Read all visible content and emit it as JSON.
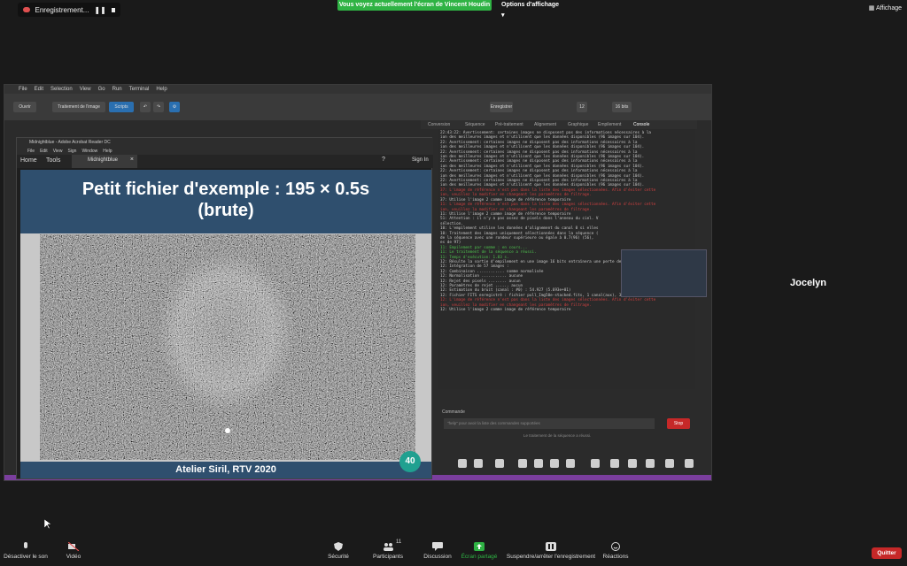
{
  "zoom": {
    "recording_label": "Enregistrement...",
    "share_banner": "Vous voyez actuellement l'écran de Vincent Houdin",
    "view_options": "Options d'affichage",
    "display_btn": "Affichage",
    "participant_name": "Jocelyn",
    "bottom": {
      "mute": "Désactiver le son",
      "video": "Vidéo",
      "security": "Sécurité",
      "participants": "Participants",
      "participants_count": "11",
      "discussion": "Discussion",
      "share": "Écran partagé",
      "record": "Suspendre/arrêter l'enregistrement",
      "reactions": "Réactions",
      "quit": "Quitter"
    }
  },
  "siril": {
    "menu": [
      "File",
      "Edit",
      "Selection",
      "View",
      "Go",
      "Run",
      "Terminal",
      "Help"
    ],
    "toolbar": {
      "open": "Ouvrir",
      "image_processing": "Traitement de l'image",
      "scripts": "Scripts",
      "save": "Enregistrer",
      "zoom_value": "12",
      "bits": "16 bits"
    },
    "tabs": [
      "Conversion",
      "Séquence",
      "Pré-traitement",
      "Alignement",
      "Graphique",
      "Empilement",
      "Console"
    ],
    "console_lines": [
      {
        "t": "22:43:22: Avertissement: certaines images ne disposent pas des informations nécessaires à la",
        "c": ""
      },
      {
        "t": "ion des meilleures images et n'utilisent que les données disponibles (96 images sur 104).",
        "c": ""
      },
      {
        "t": "22: Avertissement: certaines images ne disposent pas des informations nécessaires à la",
        "c": ""
      },
      {
        "t": "ion des meilleures images et n'utilisent que les données disponibles (96 images sur 104).",
        "c": ""
      },
      {
        "t": "22: Avertissement: certaines images ne disposent pas des informations nécessaires à la",
        "c": ""
      },
      {
        "t": "ion des meilleures images et n'utilisent que les données disponibles (96 images sur 104).",
        "c": ""
      },
      {
        "t": "22: Avertissement: certaines images ne disposent pas des informations nécessaires à la",
        "c": ""
      },
      {
        "t": "ion des meilleures images et n'utilisent que les données disponibles (96 images sur 104).",
        "c": ""
      },
      {
        "t": "22: Avertissement: certaines images ne disposent pas des informations nécessaires à la",
        "c": ""
      },
      {
        "t": "ion des meilleures images et n'utilisent que les données disponibles (96 images sur 104).",
        "c": ""
      },
      {
        "t": "22: Avertissement: certaines images ne disposent pas des informations nécessaires à la",
        "c": ""
      },
      {
        "t": "ion des meilleures images et n'utilisent que les données disponibles (96 images sur 104).",
        "c": ""
      },
      {
        "t": "37: L'image de référence n'est pas dans la liste des images sélectionnées. Afin d'éviter cette",
        "c": "red"
      },
      {
        "t": "ion, veuillez la modifier en changeant les paramètres de filtrage.",
        "c": "red"
      },
      {
        "t": "37: Utilise l'image 2 comme image de référence temporaire",
        "c": ""
      },
      {
        "t": "11: L'image de référence n'est pas dans la liste des images sélectionnées. Afin d'éviter cette",
        "c": "red"
      },
      {
        "t": "ion, veuillez la modifier en changeant les paramètres de filtrage.",
        "c": "red"
      },
      {
        "t": "11: Utilise l'image 2 comme image de référence temporaire",
        "c": ""
      },
      {
        "t": "51: Attention : il n'y a pas assez de pixels dans l'anneau du ciel. V",
        "c": ""
      },
      {
        "t": " sélection.",
        "c": ""
      },
      {
        "t": "10: L'empilement utilise les données d'alignement du canal 0 si elles",
        "c": ""
      },
      {
        "t": "10: Traitement des images uniquement sélectionnées dans la séquence (",
        "c": ""
      },
      {
        "t": " de la séquence avec une rondeur supérieure ou égale à 0.7(96) (56),",
        "c": ""
      },
      {
        "t": "es de 97)",
        "c": ""
      },
      {
        "t": "11: Empilement par somme : en cours...",
        "c": "green"
      },
      {
        "t": "11: Le traitement de la séquence a réussi.",
        "c": "green"
      },
      {
        "t": "11: Temps d'exécution: 1.83 s.",
        "c": "green"
      },
      {
        "t": "12: Résulte la sortie d'empilement en une image 16 bits entraînera une perte de précision",
        "c": ""
      },
      {
        "t": "12: Intégration de 57 images :",
        "c": ""
      },
      {
        "t": "12: Combinaison ............ somme normalisée",
        "c": ""
      },
      {
        "t": "12: Normalisation ........... aucune",
        "c": ""
      },
      {
        "t": "12: Rejet des pixels ........ aucun",
        "c": ""
      },
      {
        "t": "12: Paramètres de rejet ...... aucun",
        "c": ""
      },
      {
        "t": "12: Estimation du bruit (canal : #0) : 54.927 (5.693e+01)",
        "c": ""
      },
      {
        "t": "12: Fichier FITS enregistré : fichier pull_Img50e-stacked.fits, 1 canal(aux), 3024x3024 pixels",
        "c": ""
      },
      {
        "t": "12: L'image de référence n'est pas dans la liste des images sélectionnées. Afin d'éviter cette",
        "c": "red"
      },
      {
        "t": "ion, veuillez la modifier en changeant les paramètres de filtrage.",
        "c": "red"
      },
      {
        "t": "12: Utilise l'image 2 comme image de référence temporaire",
        "c": ""
      }
    ],
    "command_label": "Commande",
    "command_placeholder": "\"help\" pour avoir la liste des commandes supportées",
    "stop": "Stop",
    "status": "Le traitement de la séquence a réussi."
  },
  "acrobat": {
    "title": "Midnightblue - Adobe Acrobat Reader DC",
    "menu": [
      "File",
      "Edit",
      "View",
      "Sign",
      "Window",
      "Help"
    ],
    "nav_home": "Home",
    "nav_tools": "Tools",
    "doc_tab": "Midnightblue",
    "sign_in": "Sign In",
    "slide_title_line1": "Petit fichier d'exemple : 195 × 0.5s",
    "slide_title_line2": "(brute)",
    "slide_footer": "Atelier Siril, RTV 2020",
    "page_number": "40"
  }
}
